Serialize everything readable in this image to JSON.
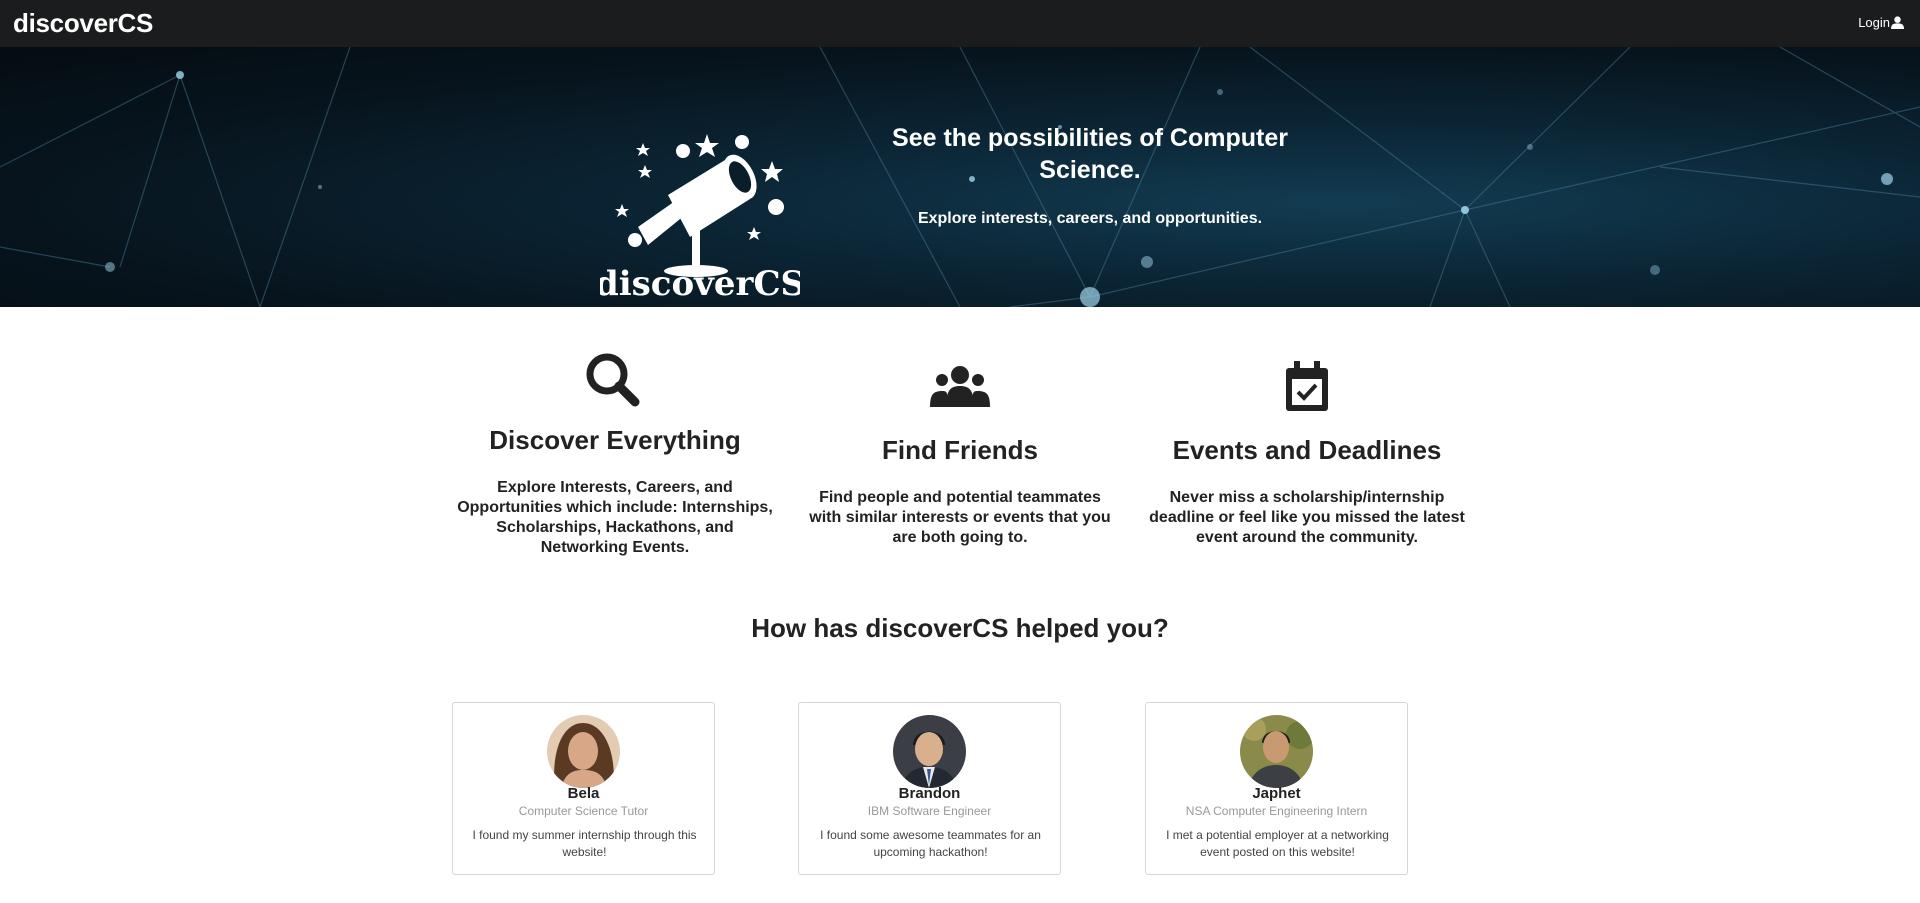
{
  "navbar": {
    "brand": "discoverCS",
    "login_label": "Login",
    "login_icon": "user-icon"
  },
  "hero": {
    "logo_text": "discoverCS",
    "title": "See the possibilities of Computer Science.",
    "subtitle": "Explore interests, careers, and opportunities."
  },
  "features": [
    {
      "icon": "search-icon",
      "title": "Discover Everything",
      "description": "Explore Interests, Careers, and Opportunities which include: Internships, Scholarships, Hackathons, and Networking Events."
    },
    {
      "icon": "users-icon",
      "title": "Find Friends",
      "description": "Find people and potential teammates with similar interests or events that you are both going to."
    },
    {
      "icon": "calendar-check-icon",
      "title": "Events and Deadlines",
      "description": "Never miss a scholarship/internship deadline or feel like you missed the latest event around the community."
    }
  ],
  "testimonials_title": "How has discoverCS helped you?",
  "testimonials": [
    {
      "name": "Bela",
      "role": "Computer Science Tutor",
      "quote": "I found my summer internship through this website!"
    },
    {
      "name": "Brandon",
      "role": "IBM Software Engineer",
      "quote": "I found some awesome teammates for an upcoming hackathon!"
    },
    {
      "name": "Japhet",
      "role": "NSA Computer Engineering Intern",
      "quote": "I met a potential employer at a networking event posted on this website!"
    }
  ],
  "colors": {
    "navbar_bg": "#1b1c1e",
    "hero_bg": "#0b2535",
    "text": "#222222",
    "muted": "#999999"
  }
}
